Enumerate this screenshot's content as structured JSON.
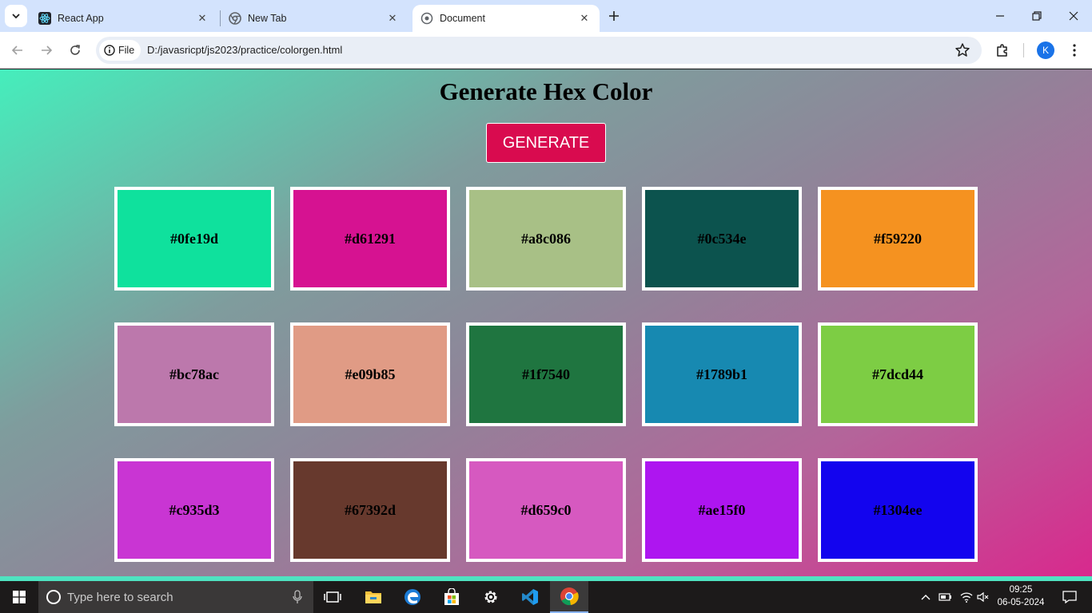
{
  "browser": {
    "tabs": [
      {
        "title": "React App",
        "icon": "react-icon",
        "active": false
      },
      {
        "title": "New Tab",
        "icon": "chrome-icon",
        "active": false
      },
      {
        "title": "Document",
        "icon": "globe-icon",
        "active": true
      }
    ],
    "address": {
      "chip_label": "File",
      "url": "D:/javasricpt/js2023/practice/colorgen.html"
    },
    "profile_initial": "K"
  },
  "page": {
    "title": "Generate Hex Color",
    "generate_label": "GENERATE",
    "button_color": "#d90b4f",
    "swatches": [
      {
        "hex": "#0fe19d"
      },
      {
        "hex": "#d61291"
      },
      {
        "hex": "#a8c086"
      },
      {
        "hex": "#0c534e"
      },
      {
        "hex": "#f59220"
      },
      {
        "hex": "#bc78ac"
      },
      {
        "hex": "#e09b85"
      },
      {
        "hex": "#1f7540"
      },
      {
        "hex": "#1789b1"
      },
      {
        "hex": "#7dcd44"
      },
      {
        "hex": "#c935d3"
      },
      {
        "hex": "#67392d"
      },
      {
        "hex": "#d659c0"
      },
      {
        "hex": "#ae15f0"
      },
      {
        "hex": "#1304ee"
      }
    ]
  },
  "taskbar": {
    "search_placeholder": "Type here to search",
    "apps": [
      "task-view-icon",
      "file-explorer-icon",
      "edge-icon",
      "store-icon",
      "settings-icon",
      "vscode-icon",
      "chrome-icon"
    ],
    "clock_time": "09:25",
    "clock_date": "06-05-2024"
  }
}
